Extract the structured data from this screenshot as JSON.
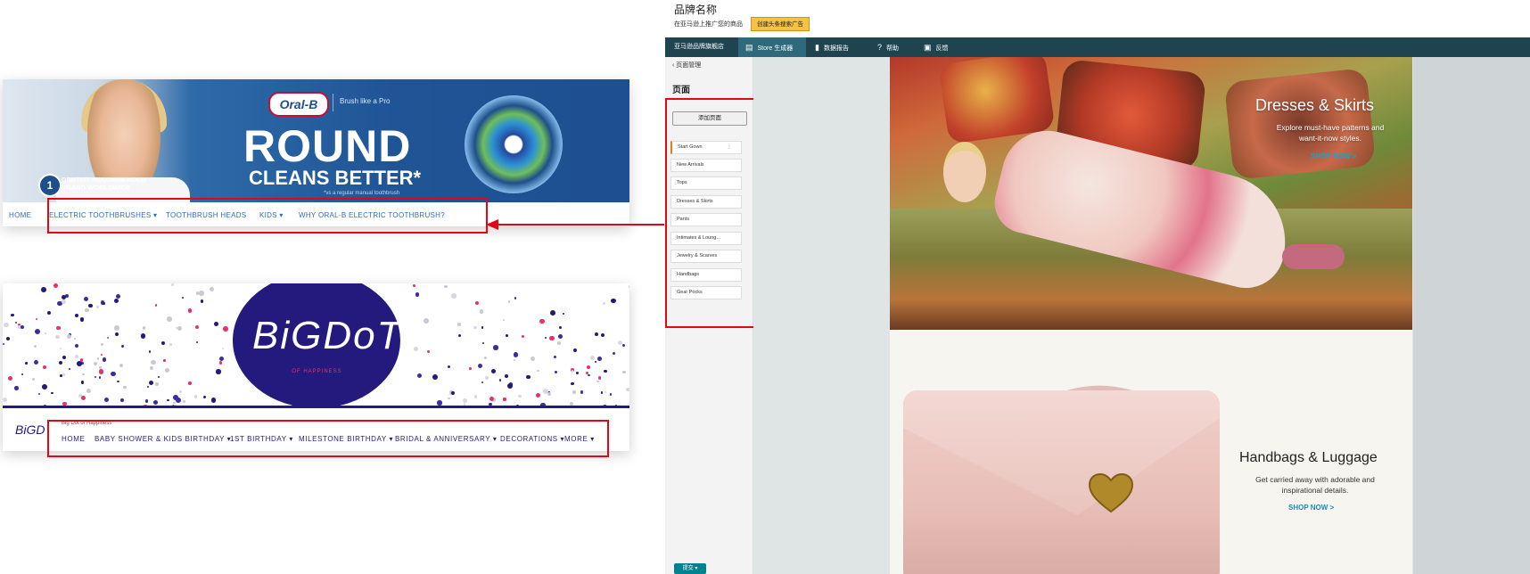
{
  "oralb": {
    "logo": "Oral-B",
    "tagline": "Brush like a Pro",
    "headline": "ROUND",
    "subheadline": "CLEANS BETTER*",
    "small_print": "*vs a regular manual toothbrush",
    "badge_number": "1",
    "badge_text": "DENTIST RECOMMENDED BRAND WORLDWIDE",
    "nav": [
      "HOME",
      "ELECTRIC TOOTHBRUSHES ▾",
      "TOOTHBRUSH HEADS",
      "KIDS ▾",
      "WHY ORAL-B ELECTRIC TOOTHBRUSH?"
    ]
  },
  "bigdot": {
    "logo": "BiGDoT",
    "logo_sub": "OF HAPPINESS",
    "mini_logo": "BiGD",
    "tagline": "Big Dot of Happiness",
    "nav": [
      "HOME",
      "BABY SHOWER & KIDS BIRTHDAY ▾",
      "1ST BIRTHDAY ▾",
      "MILESTONE BIRTHDAY ▾",
      "BRIDAL & ANNIVERSARY ▾",
      "DECORATIONS ▾",
      "MORE ▾"
    ]
  },
  "seller_central": {
    "title": "品牌名称",
    "subtitle": "在亚马逊上推广您的商品",
    "promote_button": "创建头条搜索广告",
    "tabs": [
      {
        "icon": "",
        "label": "亚马逊品牌旗舰店"
      },
      {
        "icon": "▤",
        "label": "Store 生成器"
      },
      {
        "icon": "▮",
        "label": "数据报告"
      },
      {
        "icon": "?",
        "label": "帮助"
      },
      {
        "icon": "▣",
        "label": "反馈"
      }
    ],
    "sidebar": {
      "back": "‹  页面管理",
      "section": "页面",
      "add_page": "添加页面",
      "pages": [
        "Start Gown",
        "New Arrivals",
        "Tops",
        "Dresses & Skirts",
        "Pants",
        "Intimates & Loung...",
        "Jewelry & Scarves",
        "Handbags",
        "Gear Pocks"
      ],
      "save": "提交 ▾"
    },
    "hero1": {
      "title": "Dresses & Skirts",
      "desc": "Explore must-have patterns and want-it-now styles.",
      "cta": "SHOP NOW >"
    },
    "hero2": {
      "title": "Handbags & Luggage",
      "desc": "Get carried away with adorable and inspirational details.",
      "cta": "SHOP NOW >"
    }
  },
  "colors": {
    "highlight_red": "#e30613",
    "oralb_blue": "#1f5596",
    "bigdot_navy": "#241a7e",
    "seller_tabbar": "#1f4450",
    "cta_blue": "#1aa3c9"
  }
}
